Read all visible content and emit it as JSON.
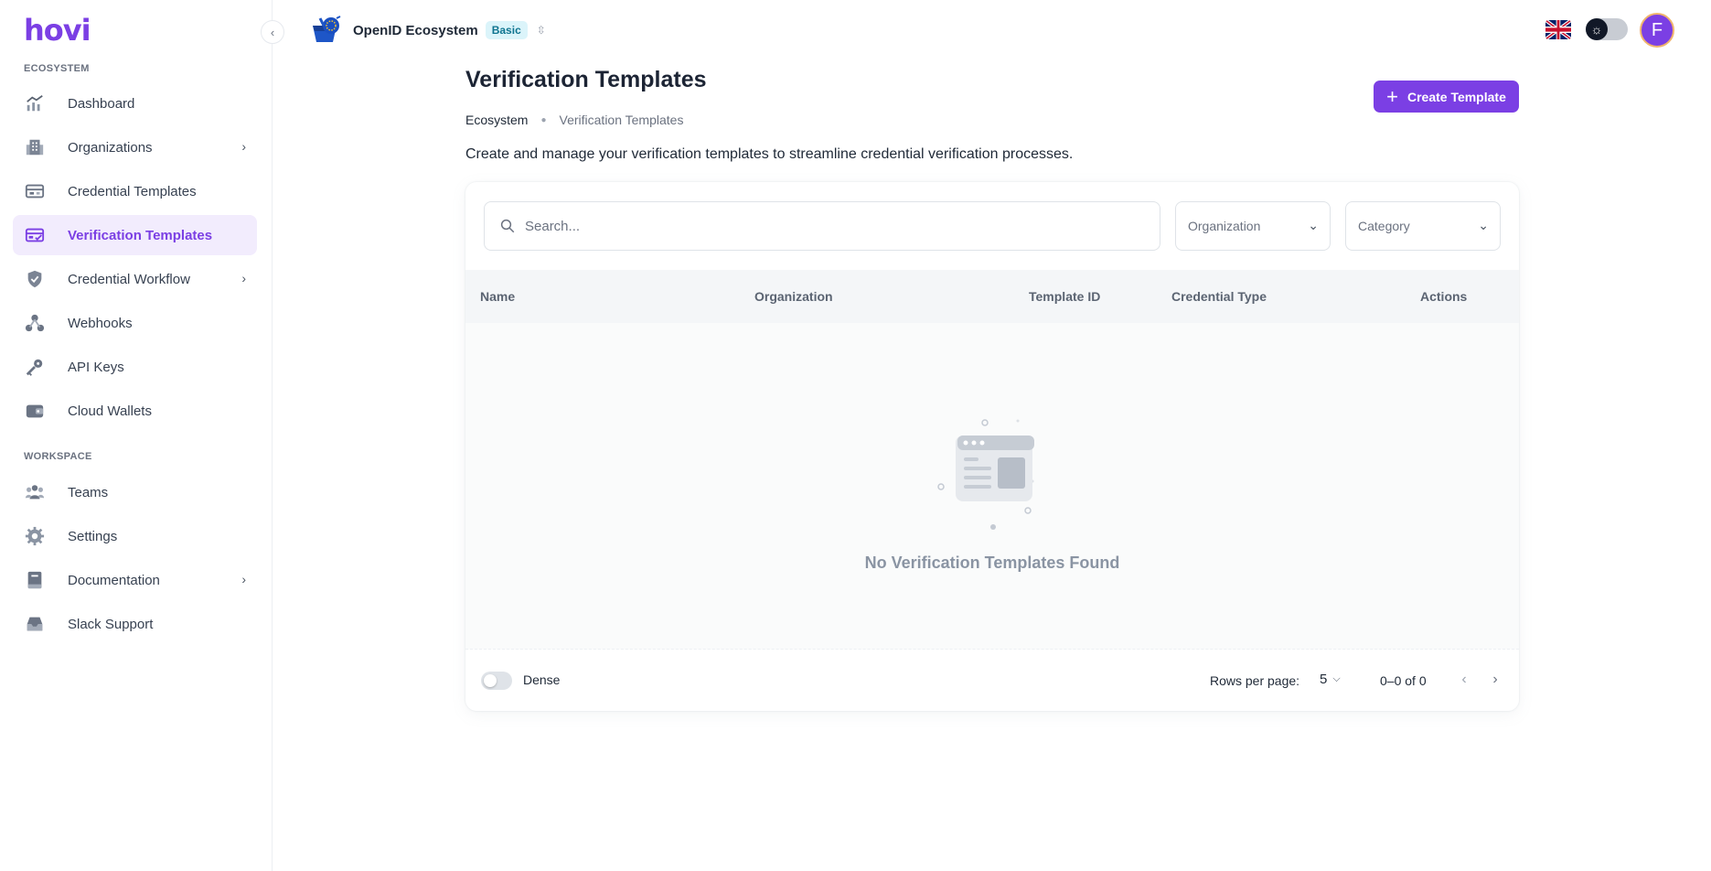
{
  "app": {
    "logo_text": "hovi",
    "brand_color": "#7b3fe4"
  },
  "sidebar": {
    "sections": [
      {
        "label": "ECOSYSTEM"
      },
      {
        "label": "WORKSPACE"
      }
    ],
    "items": [
      {
        "label": "Dashboard",
        "icon": "chart-line-icon"
      },
      {
        "label": "Organizations",
        "icon": "building-icon",
        "has_submenu": true
      },
      {
        "label": "Credential Templates",
        "icon": "credential-card-icon"
      },
      {
        "label": "Verification Templates",
        "icon": "verification-card-icon",
        "active": true
      },
      {
        "label": "Credential Workflow",
        "icon": "shield-check-icon",
        "has_submenu": true
      },
      {
        "label": "Webhooks",
        "icon": "webhook-icon"
      },
      {
        "label": "API Keys",
        "icon": "key-icon"
      },
      {
        "label": "Cloud Wallets",
        "icon": "wallet-icon"
      },
      {
        "label": "Teams",
        "icon": "team-icon"
      },
      {
        "label": "Settings",
        "icon": "gear-icon"
      },
      {
        "label": "Documentation",
        "icon": "book-icon",
        "has_submenu": true
      },
      {
        "label": "Slack Support",
        "icon": "inbox-icon"
      }
    ]
  },
  "topbar": {
    "ecosystem_name": "OpenID Ecosystem",
    "plan_badge": "Basic",
    "avatar_initial": "F",
    "language_flag": "uk-flag-icon"
  },
  "page": {
    "title": "Verification Templates",
    "breadcrumb": [
      "Ecosystem",
      "Verification Templates"
    ],
    "description": "Create and manage your verification templates to streamline credential verification processes.",
    "create_button": "Create Template"
  },
  "filters": {
    "search_placeholder": "Search...",
    "organization_placeholder": "Organization",
    "category_placeholder": "Category"
  },
  "table": {
    "columns": [
      "Name",
      "Organization",
      "Template ID",
      "Credential Type",
      "Actions"
    ],
    "rows": [],
    "empty_text": "No Verification Templates Found"
  },
  "pagination": {
    "dense_label": "Dense",
    "dense": false,
    "rows_per_page_label": "Rows per page:",
    "rows_per_page": "5",
    "range": "0–0 of 0"
  }
}
